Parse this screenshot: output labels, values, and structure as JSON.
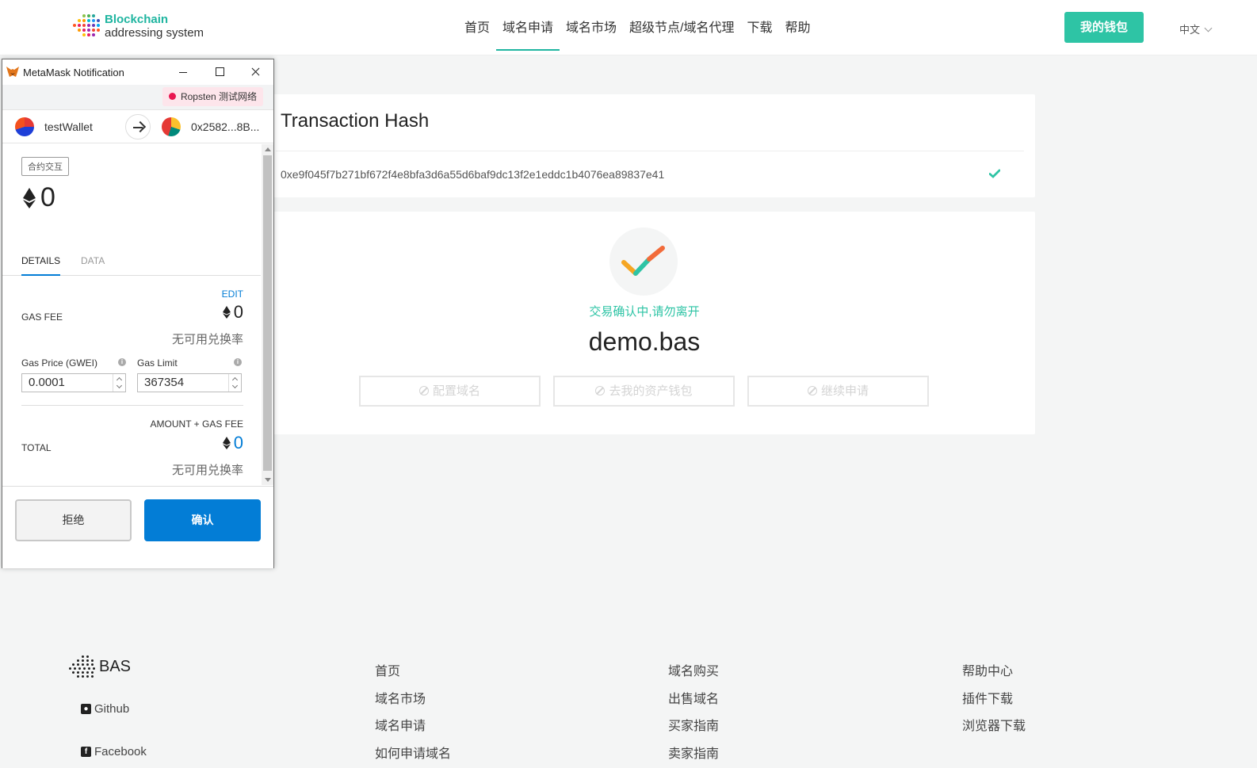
{
  "header": {
    "logo_line1": "Blockchain",
    "logo_line2": "addressing system",
    "nav": [
      "首页",
      "域名申请",
      "域名市场",
      "超级节点/域名代理",
      "下载",
      "帮助"
    ],
    "active_nav": "域名申请",
    "wallet_button": "我的钱包",
    "language": "中文"
  },
  "transaction": {
    "title": "Transaction Hash",
    "hash": "0xe9f045f7b271bf672f4e8bfa3d6a55d6baf9dc13f2e1eddc1b4076ea89837e41",
    "status_icon": "check-icon"
  },
  "status": {
    "message": "交易确认中,请勿离开",
    "domain": "demo.bas",
    "buttons": [
      "配置域名",
      "去我的资产钱包",
      "继续申请"
    ]
  },
  "footer": {
    "brand": "BAS",
    "social": [
      "Github",
      "Facebook"
    ],
    "col1": [
      "首页",
      "域名市场",
      "域名申请",
      "如何申请域名"
    ],
    "col2": [
      "域名购买",
      "出售域名",
      "买家指南",
      "卖家指南"
    ],
    "col3": [
      "帮助中心",
      "插件下载",
      "浏览器下载"
    ]
  },
  "metamask": {
    "window_title": "MetaMask Notification",
    "network": "Ropsten 测试网络",
    "from_account": "testWallet",
    "to_account": "0x2582...8B...",
    "tag": "合约交互",
    "amount": "0",
    "tabs": [
      "DETAILS",
      "DATA"
    ],
    "edit_label": "EDIT",
    "gas_fee_label": "GAS FEE",
    "gas_fee_value": "0",
    "no_rate": "无可用兑换率",
    "gas_price_label": "Gas Price (GWEI)",
    "gas_price_value": "0.0001",
    "gas_limit_label": "Gas Limit",
    "gas_limit_value": "367354",
    "amount_gas_label": "AMOUNT + GAS FEE",
    "total_label": "TOTAL",
    "total_value": "0",
    "reject_button": "拒绝",
    "confirm_button": "确认"
  },
  "colors": {
    "accent": "#2ec4a5",
    "metamask_blue": "#037dd6",
    "network_dot": "#e91550"
  }
}
